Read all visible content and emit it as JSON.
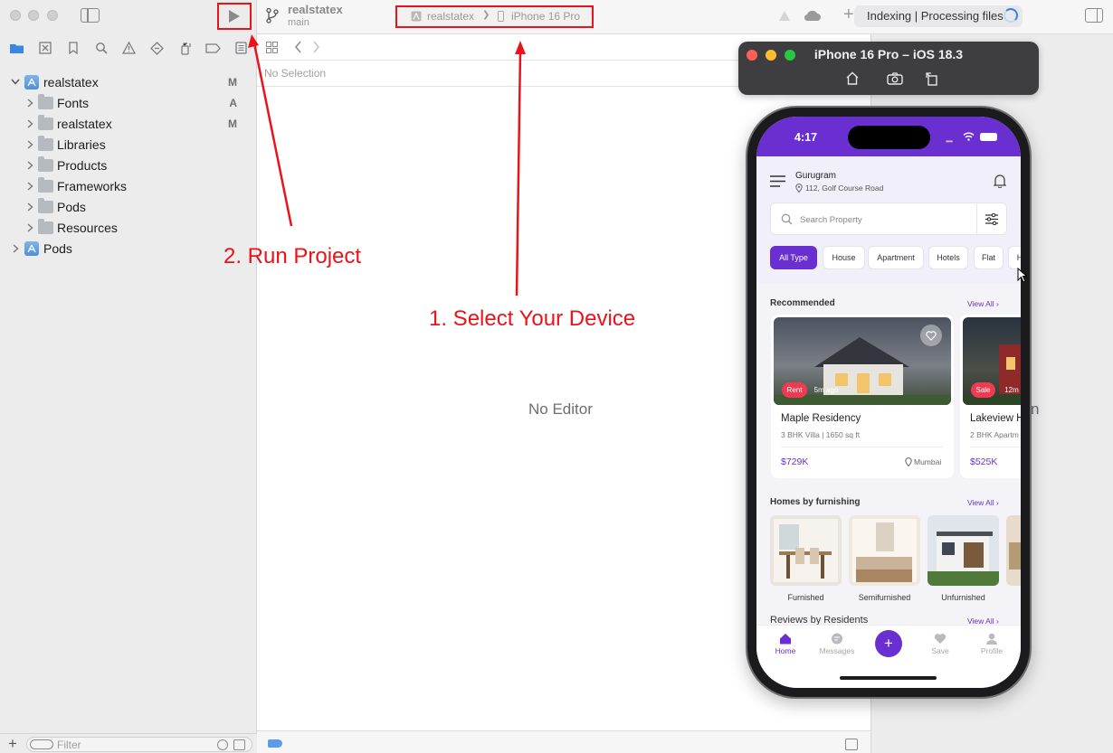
{
  "xcode": {
    "project": {
      "name": "realstatex",
      "branch": "main"
    },
    "scheme": {
      "target": "realstatex",
      "separator": "❯",
      "device": "iPhone 16 Pro"
    },
    "status": {
      "text": "Indexing | Processing files"
    },
    "navigator": {
      "items": [
        {
          "label": "realstatex",
          "badge": "M",
          "kind": "project",
          "expanded": true
        },
        {
          "label": "Fonts",
          "badge": "A",
          "kind": "folder"
        },
        {
          "label": "realstatex",
          "badge": "M",
          "kind": "folder"
        },
        {
          "label": "Libraries",
          "badge": "",
          "kind": "folder"
        },
        {
          "label": "Products",
          "badge": "",
          "kind": "folder"
        },
        {
          "label": "Frameworks",
          "badge": "",
          "kind": "folder"
        },
        {
          "label": "Pods",
          "badge": "",
          "kind": "folder"
        },
        {
          "label": "Resources",
          "badge": "",
          "kind": "folder"
        },
        {
          "label": "Pods",
          "badge": "",
          "kind": "project"
        }
      ],
      "filter_placeholder": "Filter"
    },
    "editor": {
      "selection": "No Selection",
      "empty": "No Editor"
    },
    "right_pane_fragment": "n"
  },
  "annotations": {
    "select_device": "1. Select Your Device",
    "run_project": "2. Run Project"
  },
  "simulator": {
    "title": "iPhone 16 Pro – iOS 18.3",
    "time": "4:17",
    "app": {
      "city": "Gurugram",
      "address": "112, Golf Course Road",
      "search_placeholder": "Search Property",
      "chips": [
        "All Type",
        "House",
        "Apartment",
        "Hotels",
        "Flat",
        "H"
      ],
      "recommended_title": "Recommended",
      "view_all": "View All",
      "listings": [
        {
          "tag": "Rent",
          "time": "5m ago",
          "title": "Maple Residency",
          "sub": "3 BHK Villa | 1650 sq ft",
          "price": "$729K",
          "location": "Mumbai"
        },
        {
          "tag": "Sale",
          "time": "12m",
          "title": "Lakeview H",
          "sub": "2 BHK Apartm",
          "price": "$525K",
          "location": ""
        }
      ],
      "furnishing_title": "Homes by furnishing",
      "furnishing": [
        "Furnished",
        "Semifurnished",
        "Unfurnished"
      ],
      "reviews_title": "Reviews by Residents",
      "tabs": {
        "home": "Home",
        "messages": "Messages",
        "add": "+",
        "save": "Save",
        "profile": "Profile"
      }
    }
  },
  "colors": {
    "annotation": "#e8141a",
    "accent": "#6a2fd0",
    "rent_tag": "#ef3b52"
  }
}
